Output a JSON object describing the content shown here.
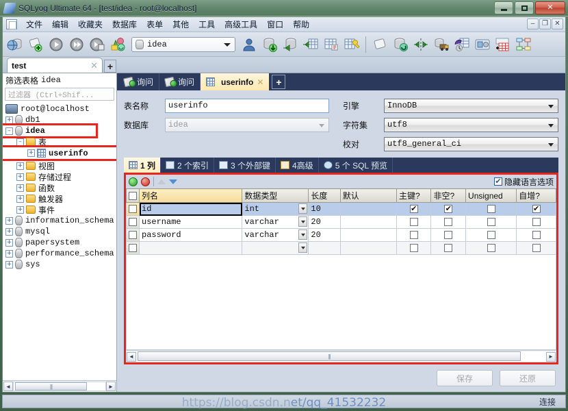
{
  "window": {
    "title": "SQLyog Ultimate 64 - [test/idea - root@localhost]",
    "icon": "sqlyog-logo-icon",
    "minimize_label": "–",
    "maximize_label": "□",
    "close_label": "✕"
  },
  "mdi_buttons": {
    "minimize": "–",
    "restore": "❐",
    "close": "✕"
  },
  "menu": {
    "items": [
      {
        "label": "文件"
      },
      {
        "label": "编辑"
      },
      {
        "label": "收藏夹"
      },
      {
        "label": "数据库"
      },
      {
        "label": "表单"
      },
      {
        "label": "其他"
      },
      {
        "label": "工具"
      },
      {
        "label": "高级工具"
      },
      {
        "label": "窗口"
      },
      {
        "label": "帮助"
      }
    ]
  },
  "toolbar": {
    "db_selector_value": "idea",
    "icons_left": [
      "new-connection-icon",
      "new-query-icon",
      "execute-query-icon",
      "execute-all-queries-icon",
      "execute-query-stop-icon",
      "refresh-object-icon"
    ],
    "icons_right": [
      "import-data-icon",
      "export-data-icon",
      "export-table-icon",
      "create-table-icon",
      "manage-index-icon",
      "new-query-tab-icon",
      "sync-database-icon",
      "data-sync-icon",
      "backup-icon",
      "restore-icon",
      "schema-designer-icon",
      "table-diagnostics-icon",
      "schema-tree-icon"
    ]
  },
  "connection_tabs": {
    "tabs": [
      {
        "label": "test",
        "close": "✕"
      }
    ],
    "add_label": "+"
  },
  "sidebar": {
    "header": "筛选表格",
    "header_db": "idea",
    "filter_placeholder": "过滤器 (Ctrl+Shif...",
    "tree": [
      {
        "label": "root@localhost",
        "icon": "server-icon",
        "depth": 0,
        "expander": "",
        "mono": true
      },
      {
        "label": "db1",
        "icon": "database-icon",
        "depth": 1,
        "expander": "+",
        "mono": true
      },
      {
        "label": "idea",
        "icon": "database-icon",
        "depth": 1,
        "expander": "–",
        "mono": true,
        "bold": true,
        "highlight": true
      },
      {
        "label": "表",
        "icon": "folder-icon",
        "depth": 2,
        "expander": "–",
        "mono": false
      },
      {
        "label": "userinfo",
        "icon": "table-icon",
        "depth": 3,
        "expander": "+",
        "mono": true,
        "highlight": true
      },
      {
        "label": "视图",
        "icon": "folder-icon",
        "depth": 2,
        "expander": "+",
        "mono": false
      },
      {
        "label": "存储过程",
        "icon": "folder-icon",
        "depth": 2,
        "expander": "+",
        "mono": false
      },
      {
        "label": "函数",
        "icon": "folder-icon",
        "depth": 2,
        "expander": "+",
        "mono": false
      },
      {
        "label": "触发器",
        "icon": "folder-icon",
        "depth": 2,
        "expander": "+",
        "mono": false
      },
      {
        "label": "事件",
        "icon": "folder-icon",
        "depth": 2,
        "expander": "+",
        "mono": false
      },
      {
        "label": "information_schema",
        "icon": "database-icon",
        "depth": 1,
        "expander": "+",
        "mono": true
      },
      {
        "label": "mysql",
        "icon": "database-icon",
        "depth": 1,
        "expander": "+",
        "mono": true
      },
      {
        "label": "papersystem",
        "icon": "database-icon",
        "depth": 1,
        "expander": "+",
        "mono": true
      },
      {
        "label": "performance_schema",
        "icon": "database-icon",
        "depth": 1,
        "expander": "+",
        "mono": true
      },
      {
        "label": "sys",
        "icon": "database-icon",
        "depth": 1,
        "expander": "+",
        "mono": true
      }
    ],
    "scroll_left_arrow": "◄",
    "scroll_right_arrow": "►"
  },
  "object_tabs": {
    "tabs": [
      {
        "label": "询问",
        "icon": "query-icon",
        "active": false,
        "close": ""
      },
      {
        "label": "询问",
        "icon": "query-icon",
        "active": false,
        "close": ""
      },
      {
        "label": "userinfo",
        "icon": "table-icon",
        "active": true,
        "close": "✕"
      }
    ],
    "add_label": "+"
  },
  "table_form": {
    "name_label": "表名称",
    "name_value": "userinfo",
    "database_label": "数据库",
    "database_value": "idea",
    "engine_label": "引擎",
    "engine_value": "InnoDB",
    "charset_label": "字符集",
    "charset_value": "utf8",
    "collation_label": "校对",
    "collation_value": "utf8_general_ci"
  },
  "sub_tabs": [
    {
      "label": "1 列",
      "icon": "columns-icon",
      "active": true
    },
    {
      "label": "2 个索引",
      "icon": "index-icon",
      "active": false
    },
    {
      "label": "3 个外部键",
      "icon": "foreign-key-icon",
      "active": false
    },
    {
      "label": "4高级",
      "icon": "advanced-icon",
      "active": false
    },
    {
      "label": "5 个 SQL 预览",
      "icon": "sql-preview-icon",
      "active": false
    }
  ],
  "grid_toolbar": {
    "add_icon": "add-column-icon",
    "remove_icon": "remove-column-icon",
    "move_up_icon": "move-up-icon",
    "move_down_icon": "move-down-icon",
    "hide_language_label": "隐藏语言选项",
    "hide_language_checked": true,
    "checkmark": "✔"
  },
  "columns_grid": {
    "headers": [
      "列名",
      "数据类型",
      "长度",
      "默认",
      "主键?",
      "非空?",
      "Unsigned",
      "自增?"
    ],
    "rows": [
      {
        "name": "id",
        "datatype": "int",
        "length": "10",
        "default": "",
        "primary_key": true,
        "not_null": true,
        "unsigned": false,
        "auto_increment": true,
        "selected": true
      },
      {
        "name": "username",
        "datatype": "varchar",
        "length": "20",
        "default": "",
        "primary_key": false,
        "not_null": false,
        "unsigned": false,
        "auto_increment": false,
        "selected": false
      },
      {
        "name": "password",
        "datatype": "varchar",
        "length": "20",
        "default": "",
        "primary_key": false,
        "not_null": false,
        "unsigned": false,
        "auto_increment": false,
        "selected": false
      },
      {
        "name": "",
        "datatype": "",
        "length": "",
        "default": "",
        "primary_key": false,
        "not_null": false,
        "unsigned": false,
        "auto_increment": false,
        "selected": false
      }
    ],
    "checkmark": "✔"
  },
  "footer_buttons": {
    "save_label": "保存",
    "revert_label": "还原"
  },
  "statusbar": {
    "text": "连接"
  },
  "watermark": {
    "text": "https://blog.csdn.n",
    "text2": "et/qq_41532232"
  },
  "colors": {
    "accent_red": "#e8241b",
    "tab_active": "#ffeebe",
    "tab_strip": "#2b3a5c",
    "selection": "#b9cdea"
  }
}
